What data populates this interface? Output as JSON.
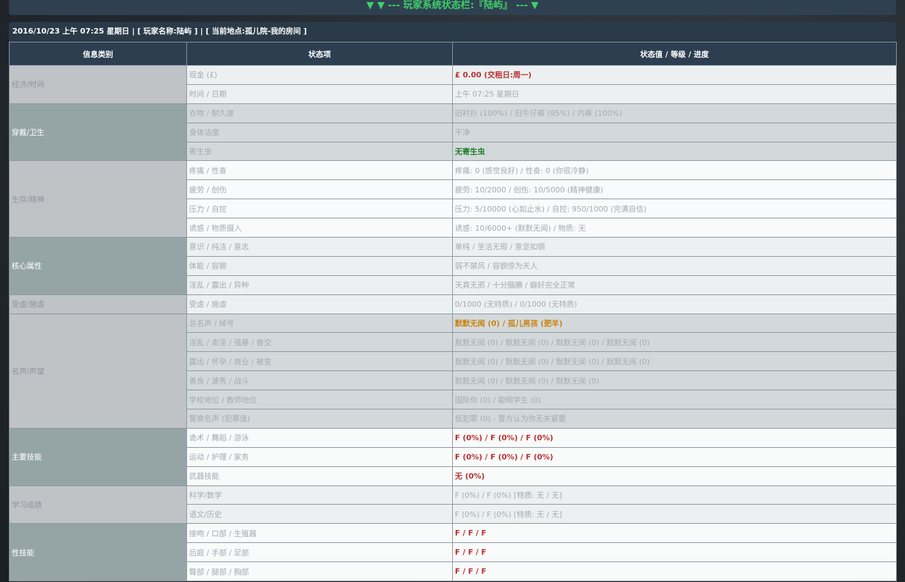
{
  "banner": {
    "text": "▼ ▼ --- 玩家系统状态栏:『陆屿』 --- ▼"
  },
  "infobar": {
    "text": "2016/10/23 上午 07:25 星期日 | [ 玩家名称:陆屿 ] | [ 当前地点:孤儿院-我的房间 ]"
  },
  "table": {
    "headers": [
      "信息类别",
      "状态项",
      "状态值 / 等级 / 进度"
    ],
    "categories": [
      "经济/时间",
      "穿戴/卫生",
      "生存/精神",
      "核心属性",
      "受虐/施虐",
      "名声/声望",
      "主要技能",
      "学习成绩",
      "性技能"
    ],
    "rows": [
      {
        "item": "现金 (£)",
        "value": "£ 0.00 (交租日:周一)"
      },
      {
        "item": "时间 / 日期",
        "value": "上午 07:25 星期日"
      },
      {
        "item": "衣物 / 耐久度",
        "value": "旧衬衫 (100%) / 旧牛仔裤 (95%) / 内裤 (100%)"
      },
      {
        "item": "身体洁度",
        "value": "干净"
      },
      {
        "item": "寄生虫",
        "value": "无寄生虫"
      },
      {
        "item": "疼痛 / 性奋",
        "value": "疼痛: 0 (感觉良好) / 性奋: 0 (你很冷静)"
      },
      {
        "item": "疲劳 / 创伤",
        "value": "疲劳: 10/2000 / 创伤: 10/5000 (精神健康)"
      },
      {
        "item": "压力 / 自控",
        "value": "压力: 5/10000 (心如止水) / 自控: 950/1000 (完满自信)"
      },
      {
        "item": "诱惑 / 物质摄入",
        "value": "诱惑: 10/6000+ (默默无闻) / 物质: 无"
      },
      {
        "item": "意识 / 纯洁 / 意志",
        "value": "单纯 / 圣洁无瑕 / 意坚如钢"
      },
      {
        "item": "体能 / 容貌",
        "value": "弱不禁风 / 容貌惊为天人"
      },
      {
        "item": "淫乱 / 露出 / 异种",
        "value": "天真无邪 / 十分腼腆 / 癖好完全正常"
      },
      {
        "item": "受虐 / 施虐",
        "value": "0/1000 (无特质) / 0/1000 (无特质)"
      },
      {
        "item": "总名声 / 绰号",
        "value": "默默无闻 (0) / 孤儿男孩 (肥羊)"
      },
      {
        "item": "淫乱 / 卖淫 / 强暴 / 兽交",
        "value": "默默无闻 (0) / 默默无闻 (0) / 默默无闻 (0) / 默默无闻 (0)"
      },
      {
        "item": "露出 / 怀孕 / 商业 / 被变",
        "value": "默默无闻 (0) / 默默无闻 (0) / 默默无闻 (0) / 默默无闻 (0)"
      },
      {
        "item": "善良 / 速秀 / 战斗",
        "value": "默默无闻 (0) / 默默无闻 (0) / 默默无闻 (0)"
      },
      {
        "item": "学校地位 / 教师地位",
        "value": "国际你 (0) / 聪明学生 (0)"
      },
      {
        "item": "警察名声 (犯罪值)",
        "value": "低犯罪 (0) - 警方认为你无关紧要"
      },
      {
        "item": "诡术 / 舞蹈 / 游泳",
        "value": "F (0%) / F (0%) / F (0%)"
      },
      {
        "item": "运动 / 护理 / 家务",
        "value": "F (0%) / F (0%) / F (0%)"
      },
      {
        "item": "武器技能",
        "value": "无 (0%)"
      },
      {
        "item": "科学/数学",
        "value": "F (0%) / F (0%) [特质: 无 / 无]"
      },
      {
        "item": "语文/历史",
        "value": "F (0%) / F (0%) [特质: 无 / 无]"
      },
      {
        "item": "接吻 / 口部 / 生殖器",
        "value": "F / F / F"
      },
      {
        "item": "后庭 / 手部 / 足部",
        "value": "F / F / F"
      },
      {
        "item": "臀部 / 腿部 / 胸部",
        "value": "F / F / F"
      }
    ]
  },
  "colors": {
    "header_bg": "#2c3e50",
    "banner_text": "#3ecf6a",
    "red_value": "#b83232",
    "green_value": "#1a7a22",
    "orange_value": "#c98412"
  }
}
